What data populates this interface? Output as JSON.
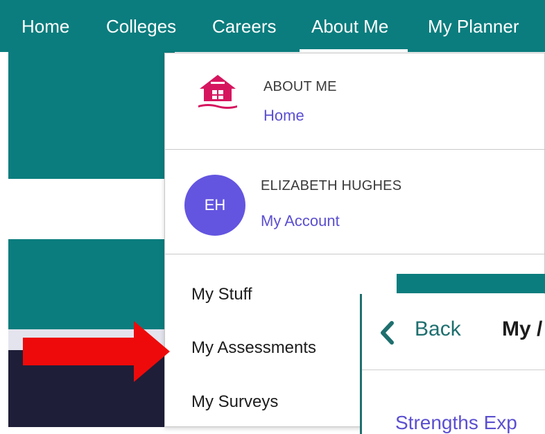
{
  "nav": {
    "items": [
      "Home",
      "Colleges",
      "Careers",
      "About Me",
      "My Planner"
    ],
    "active": "About Me"
  },
  "dropdown": {
    "section_heading": "ABOUT ME",
    "section_link": "Home",
    "user": {
      "name": "ELIZABETH HUGHES",
      "initials": "EH",
      "account_link": "My Account"
    },
    "menu_items": [
      "My Stuff",
      "My Assessments",
      "My Surveys"
    ]
  },
  "panel": {
    "back_label": "Back",
    "title_partial": "My /",
    "link_partial": "Strengths Exp"
  },
  "colors": {
    "brand_teal": "#0b7d7e",
    "link_purple": "#5b4fd0",
    "avatar_purple": "#6355e0",
    "icon_magenta": "#d6155f",
    "arrow_red": "#ee0a0a"
  },
  "icons": [
    "house-icon",
    "chevron-left-icon",
    "red-arrow-annotation"
  ]
}
